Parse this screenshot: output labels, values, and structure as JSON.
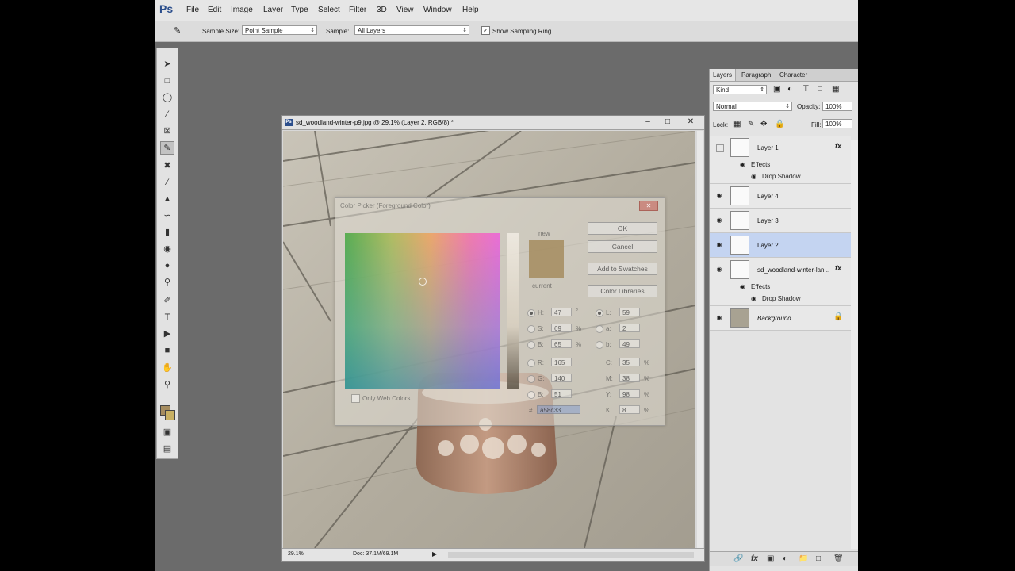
{
  "app": {
    "logo": "Ps"
  },
  "menu": [
    "File",
    "Edit",
    "Image",
    "Layer",
    "Type",
    "Select",
    "Filter",
    "3D",
    "View",
    "Window",
    "Help"
  ],
  "options": {
    "sample_size_label": "Sample Size:",
    "sample_size_value": "Point Sample",
    "sample_label": "Sample:",
    "sample_value": "All Layers",
    "show_ring_label": "Show Sampling Ring",
    "show_ring_checked": true
  },
  "document": {
    "title": "sd_woodland-winter-p9.jpg @ 29.1% (Layer 2, RGB/8) *",
    "zoom": "29.1%",
    "doc_info": "Doc: 37.1M/69.1M"
  },
  "color_picker": {
    "title": "Color Picker (Foreground Color)",
    "ok": "OK",
    "cancel": "Cancel",
    "add_swatches": "Add to Swatches",
    "color_libraries": "Color Libraries",
    "new_label": "new",
    "current_label": "current",
    "only_web": "Only Web Colors",
    "fields": [
      {
        "label": "H:",
        "value": "47",
        "unit": "°"
      },
      {
        "label": "S:",
        "value": "69",
        "unit": "%"
      },
      {
        "label": "B:",
        "value": "65",
        "unit": "%"
      },
      {
        "label": "R:",
        "value": "165",
        "unit": ""
      },
      {
        "label": "G:",
        "value": "140",
        "unit": ""
      },
      {
        "label": "B:",
        "value": "51",
        "unit": ""
      }
    ],
    "lab_fields": [
      {
        "label": "L:",
        "value": "59"
      },
      {
        "label": "a:",
        "value": "2"
      },
      {
        "label": "b:",
        "value": "49"
      }
    ],
    "cmyk_fields": [
      {
        "label": "C:",
        "value": "35",
        "unit": "%"
      },
      {
        "label": "M:",
        "value": "38",
        "unit": "%"
      },
      {
        "label": "Y:",
        "value": "98",
        "unit": "%"
      },
      {
        "label": "K:",
        "value": "8",
        "unit": "%"
      }
    ],
    "hex_label": "#",
    "hex_value": "a58c33",
    "preview_color": "#a58c5f"
  },
  "panel": {
    "tabs": [
      "Layers",
      "Paragraph",
      "Character"
    ],
    "kind_label": "Kind",
    "blend_mode": "Normal",
    "opacity_label": "Opacity:",
    "opacity_value": "100%",
    "lock_label": "Lock:",
    "fill_label": "Fill:",
    "fill_value": "100%",
    "layers": [
      {
        "name": "Layer 1",
        "visible": false,
        "fx": true
      },
      {
        "name": "Layer 4",
        "visible": true,
        "fx": false
      },
      {
        "name": "Layer 3",
        "visible": true,
        "fx": false
      },
      {
        "name": "Layer 2",
        "visible": true,
        "fx": false,
        "selected": true
      },
      {
        "name": "sd_woodland-winter-lan...",
        "visible": true,
        "fx": true
      },
      {
        "name": "Background",
        "visible": true,
        "fx": false
      }
    ],
    "effects_label": "Effects",
    "drop_shadow_label": "Drop Shadow"
  }
}
